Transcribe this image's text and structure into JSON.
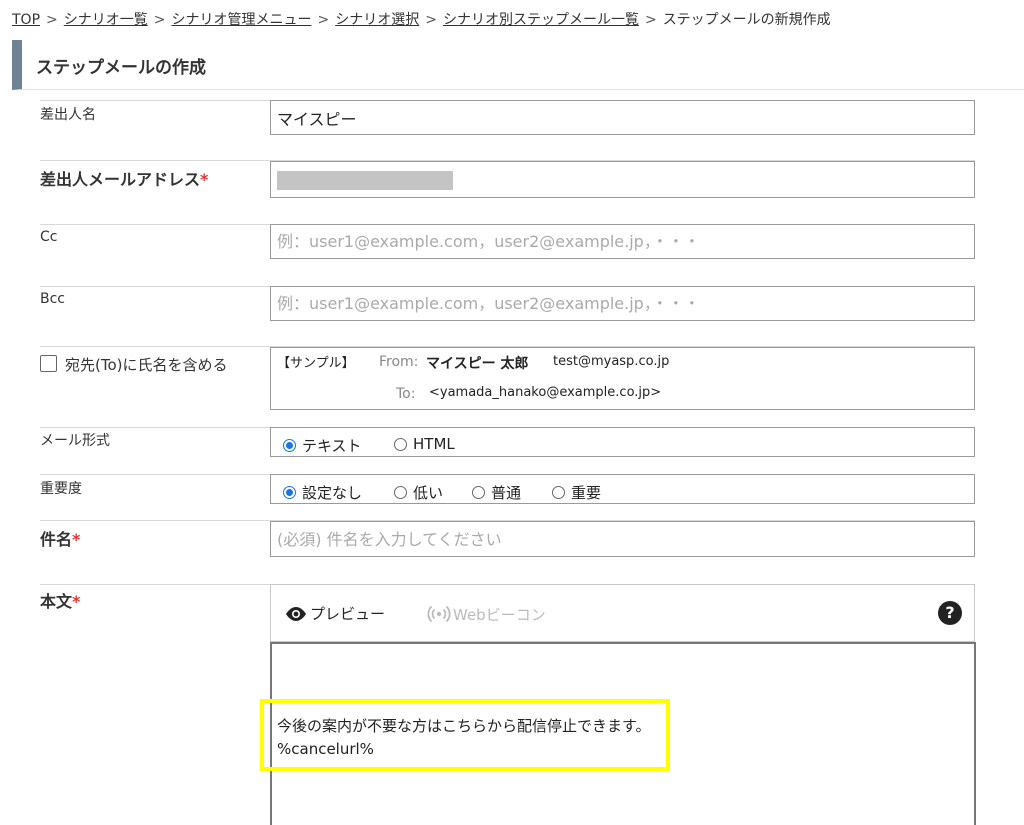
{
  "breadcrumb": {
    "items": [
      "TOP",
      "シナリオ一覧",
      "シナリオ管理メニュー",
      "シナリオ選択",
      "シナリオ別ステップメール一覧"
    ],
    "current": "ステップメールの新規作成",
    "separator": ">"
  },
  "page": {
    "title": "ステップメールの作成"
  },
  "form": {
    "sender_name": {
      "label": "差出人名",
      "value": "マイスピー"
    },
    "sender_email": {
      "label": "差出人メールアドレス",
      "required_mark": "*"
    },
    "cc": {
      "label": "Cc",
      "placeholder": "例：user1@example.com，user2@example.jp，・・・"
    },
    "bcc": {
      "label": "Bcc",
      "placeholder": "例：user1@example.com，user2@example.jp，・・・"
    },
    "include_name": {
      "label": "宛先(To)に氏名を含める",
      "checked": false,
      "sample": {
        "tag": "【サンプル】",
        "from_label": "From:",
        "from_name": "マイスピー 太郎",
        "from_address": "test@myasp.co.jp",
        "to_label": "To:",
        "to_address": "<yamada_hanako@example.co.jp>"
      }
    },
    "mail_format": {
      "label": "メール形式",
      "options": [
        "テキスト",
        "HTML"
      ],
      "selected": "テキスト"
    },
    "priority": {
      "label": "重要度",
      "options": [
        "設定なし",
        "低い",
        "普通",
        "重要"
      ],
      "selected": "設定なし"
    },
    "subject": {
      "label": "件名",
      "required_mark": "*",
      "placeholder": "(必須) 件名を入力してください"
    },
    "body": {
      "label": "本文",
      "required_mark": "*",
      "toolbar": {
        "preview": "プレビュー",
        "web_beacon": "Webビーコン",
        "help": "?"
      },
      "lines": [
        "今後の案内が不要な方はこちらから配信停止できます。",
        "%cancelurl%"
      ]
    }
  },
  "colors": {
    "accent": "#1a73e8",
    "highlight": "#ffff00",
    "required": "#e53333",
    "title_bar": "#6f8394"
  }
}
